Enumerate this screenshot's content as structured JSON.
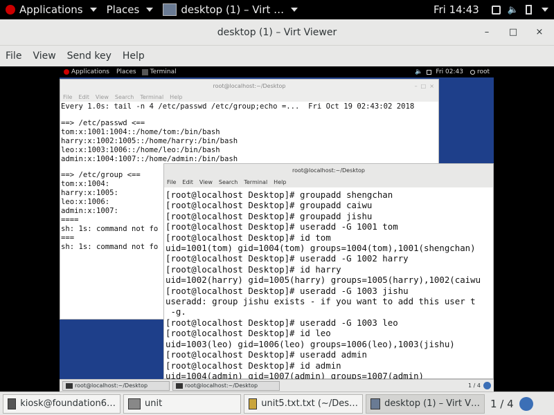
{
  "host_topbar": {
    "applications": "Applications",
    "places": "Places",
    "window_title": "desktop (1) – Virt …",
    "clock": "Fri 14:43"
  },
  "vv_window": {
    "title": "desktop (1) – Virt Viewer",
    "minimize": "–",
    "maximize": "□",
    "close": "×",
    "menu": [
      "File",
      "View",
      "Send key",
      "Help"
    ]
  },
  "guest": {
    "topbar": {
      "applications": "Applications",
      "places": "Places",
      "terminal": "Terminal",
      "clock": "Fri 02:43",
      "user": "root"
    },
    "term1": {
      "title": "root@localhost:~/Desktop",
      "menu": [
        "File",
        "Edit",
        "View",
        "Search",
        "Terminal",
        "Help"
      ],
      "lines": [
        "Every 1.0s: tail -n 4 /etc/passwd /etc/group;echo =...  Fri Oct 19 02:43:02 2018",
        "",
        "==> /etc/passwd <==",
        "tom:x:1001:1004::/home/tom:/bin/bash",
        "harry:x:1002:1005::/home/harry:/bin/bash",
        "leo:x:1003:1006::/home/leo:/bin/bash",
        "admin:x:1004:1007::/home/admin:/bin/bash",
        "",
        "==> /etc/group <==",
        "tom:x:1004:",
        "harry:x:1005:",
        "leo:x:1006:",
        "admin:x:1007:",
        "====",
        "sh: 1s: command not fo",
        "===",
        "sh: 1s: command not fo"
      ]
    },
    "term2": {
      "title": "root@localhost:~/Desktop",
      "menu": [
        "File",
        "Edit",
        "View",
        "Search",
        "Terminal",
        "Help"
      ],
      "lines": [
        "[root@localhost Desktop]# groupadd shengchan",
        "[root@localhost Desktop]# groupadd caiwu",
        "[root@localhost Desktop]# groupadd jishu",
        "[root@localhost Desktop]# useradd -G 1001 tom",
        "[root@localhost Desktop]# id tom",
        "uid=1001(tom) gid=1004(tom) groups=1004(tom),1001(shengchan)",
        "[root@localhost Desktop]# useradd -G 1002 harry",
        "[root@localhost Desktop]# id harry",
        "uid=1002(harry) gid=1005(harry) groups=1005(harry),1002(caiwu",
        "[root@localhost Desktop]# useradd -G 1003 jishu",
        "useradd: group jishu exists - if you want to add this user t",
        " -g.",
        "[root@localhost Desktop]# useradd -G 1003 leo",
        "[root@localhost Desktop]# id leo",
        "uid=1003(leo) gid=1006(leo) groups=1006(leo),1003(jishu)",
        "[root@localhost Desktop]# useradd admin",
        "[root@localhost Desktop]# id admin",
        "uid=1004(admin) gid=1007(admin) groups=1007(admin)"
      ]
    },
    "taskbar": {
      "task1": "root@localhost:~/Desktop",
      "task2": "root@localhost:~/Desktop",
      "pager": "1 / 4"
    }
  },
  "host_taskbar": {
    "tasks": [
      "kiosk@foundation6…",
      "unit",
      "unit5.txt.txt (~/Des…",
      "desktop (1) – Virt V…"
    ],
    "pager": "1 / 4"
  }
}
